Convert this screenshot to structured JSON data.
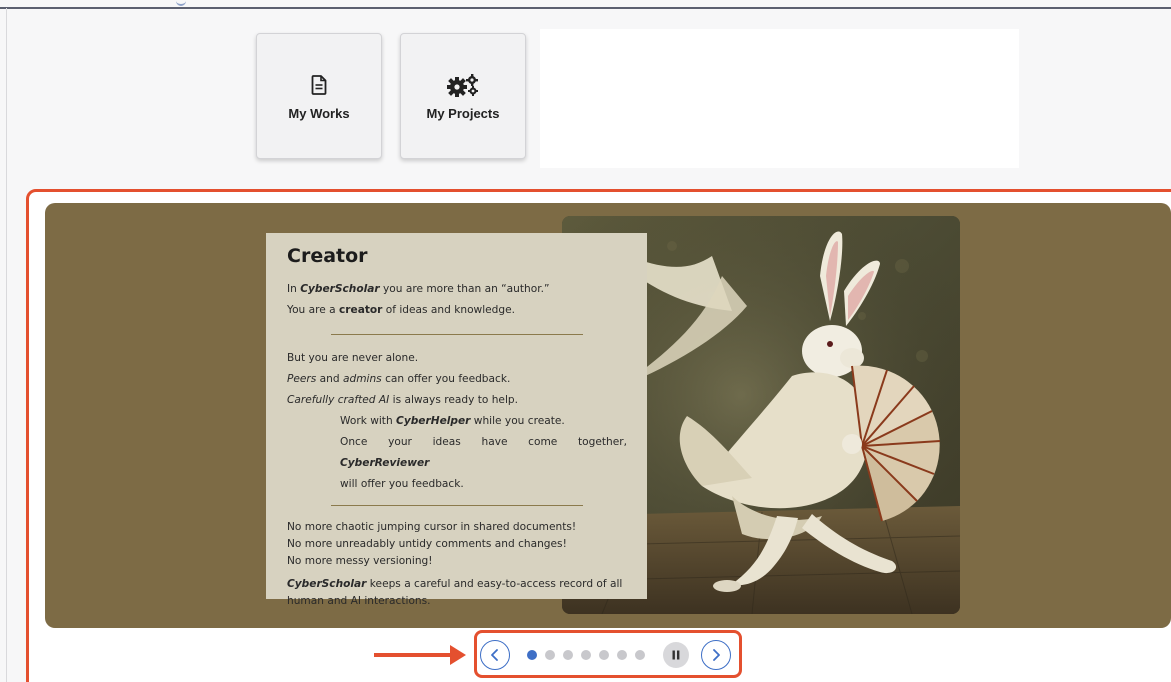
{
  "tiles": [
    {
      "label": "My Works",
      "icon": "document-icon"
    },
    {
      "label": "My Projects",
      "icon": "gears-icon"
    }
  ],
  "slide": {
    "title": "Creator",
    "para1": {
      "line1_pre": "In ",
      "line1_brand": "CyberScholar",
      "line1_post": " you are more than an “author.”",
      "line2_pre": "You are a ",
      "line2_bold": "creator",
      "line2_post": " of ideas and knowledge."
    },
    "para2": {
      "line1": "But you are never alone.",
      "line2_em1": "Peers",
      "line2_mid": " and ",
      "line2_em2": "admins",
      "line2_post": " can offer you feedback.",
      "line3_em": "Carefully crafted AI",
      "line3_post": " is always ready to help."
    },
    "indent": {
      "line1_pre": "Work with ",
      "line1_brand": "CyberHelper",
      "line1_post": " while you create.",
      "line2_pre": "Once your ideas have come together, ",
      "line2_brand": "CyberReviewer",
      "line3": "will offer you feedback."
    },
    "para3": [
      "No more chaotic jumping cursor in shared documents!",
      "No more unreadably untidy comments and changes!",
      "No more messy versioning!"
    ],
    "para4": {
      "brand": "CyberScholar",
      "text": " keeps a careful and easy-to-access record of all",
      "line2": "human and AI interactions."
    },
    "image": "white-rabbit-dancer-with-fan-painting"
  },
  "carousel": {
    "total_slides": 7,
    "active_index": 0,
    "prev_label": "‹",
    "next_label": "›",
    "pause_label": "II"
  },
  "colors": {
    "highlight": "#e4502f",
    "accent": "#3e6fc6",
    "slide_bg": "#7d6b45",
    "card_bg": "#d7d2c0"
  }
}
